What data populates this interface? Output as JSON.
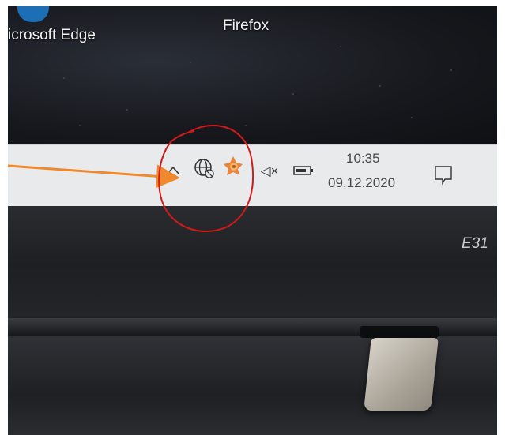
{
  "desktop": {
    "edge_label": "icrosoft Edge",
    "firefox_label": "Firefox"
  },
  "taskbar": {
    "icons": [
      "chevron-up-icon",
      "globe-icon",
      "avast-icon",
      "volume-muted-icon",
      "battery-icon",
      "notification-icon"
    ],
    "volume_glyph": "◁×",
    "time": "10:35",
    "date": "09.12.2020"
  },
  "laptop": {
    "model_label": "E31"
  },
  "annotation": {
    "arrow_color": "#f0882d",
    "circle_color": "#d11a1a"
  }
}
